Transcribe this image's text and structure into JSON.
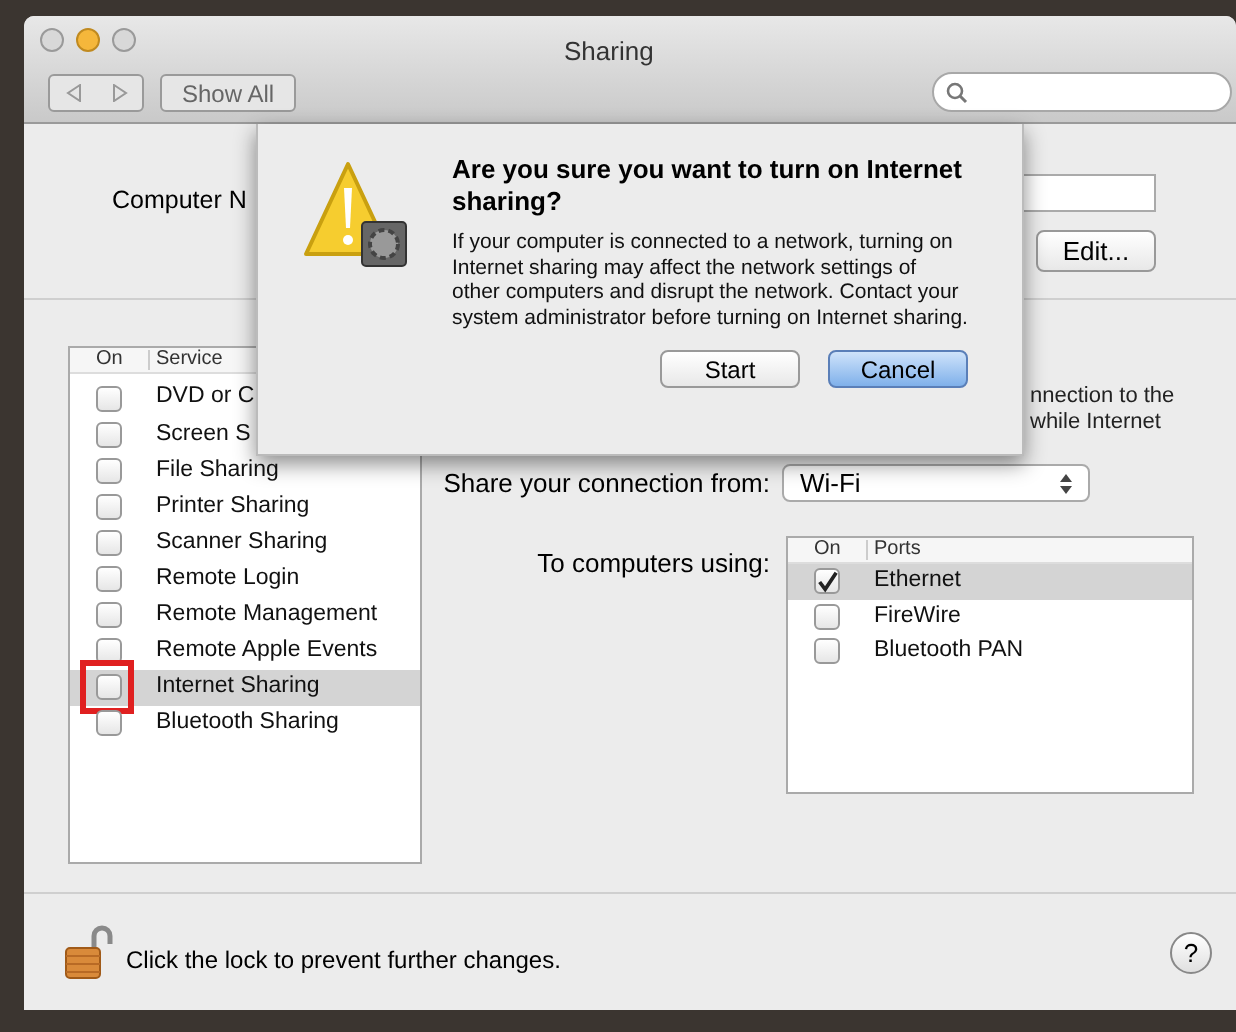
{
  "window": {
    "title": "Sharing"
  },
  "toolbar": {
    "show_all": "Show All"
  },
  "computer_name": {
    "label": "Computer N",
    "edit_button": "Edit..."
  },
  "services": {
    "columns": [
      "On",
      "Service"
    ],
    "rows": [
      {
        "name": "DVD or C",
        "checked": false,
        "selected": false
      },
      {
        "name": "Screen S",
        "checked": false,
        "selected": false
      },
      {
        "name": "File Sharing",
        "checked": false,
        "selected": false
      },
      {
        "name": "Printer Sharing",
        "checked": false,
        "selected": false
      },
      {
        "name": "Scanner Sharing",
        "checked": false,
        "selected": false
      },
      {
        "name": "Remote Login",
        "checked": false,
        "selected": false
      },
      {
        "name": "Remote Management",
        "checked": false,
        "selected": false
      },
      {
        "name": "Remote Apple Events",
        "checked": false,
        "selected": false
      },
      {
        "name": "Internet Sharing",
        "checked": false,
        "selected": true,
        "highlighted": true
      },
      {
        "name": "Bluetooth Sharing",
        "checked": false,
        "selected": false
      }
    ]
  },
  "description_lines": [
    "nnection to the",
    "while Internet"
  ],
  "share_from": {
    "label": "Share your connection from:",
    "value": "Wi-Fi"
  },
  "to_computers": {
    "label": "To computers using:",
    "columns": [
      "On",
      "Ports"
    ],
    "rows": [
      {
        "name": "Ethernet",
        "checked": true,
        "selected": true
      },
      {
        "name": "FireWire",
        "checked": false,
        "selected": false
      },
      {
        "name": "Bluetooth PAN",
        "checked": false,
        "selected": false
      }
    ]
  },
  "dialog": {
    "title": "Are you sure you want to turn on Internet sharing?",
    "message": "If your computer is connected to a network, turning on Internet sharing may affect the network settings of other computers and disrupt the network. Contact your system administrator before turning on Internet sharing.",
    "buttons": [
      {
        "label": "Start",
        "default": false
      },
      {
        "label": "Cancel",
        "default": true
      }
    ]
  },
  "footer": {
    "lock_text": "Click the lock to prevent further changes.",
    "help": "?"
  }
}
